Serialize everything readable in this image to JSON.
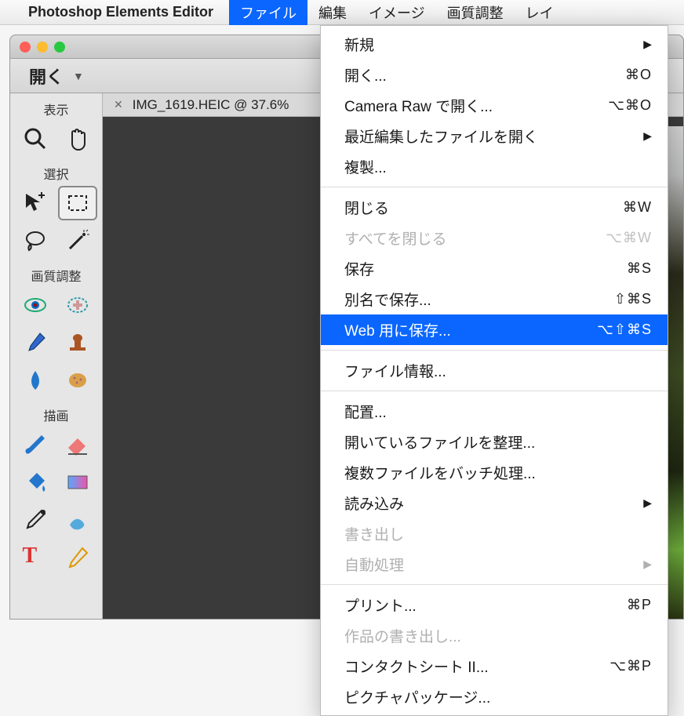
{
  "menubar": {
    "app_name": "Photoshop Elements Editor",
    "items": [
      "ファイル",
      "編集",
      "イメージ",
      "画質調整",
      "レイ"
    ]
  },
  "window": {
    "open_label": "開く"
  },
  "tools": {
    "sections": [
      "表示",
      "選択",
      "画質調整",
      "描画"
    ]
  },
  "document": {
    "tab_title": "IMG_1619.HEIC @ 37.6%"
  },
  "file_menu": [
    {
      "label": "新規",
      "shortcut": "",
      "arrow": true
    },
    {
      "label": "開く...",
      "shortcut": "⌘O"
    },
    {
      "label": "Camera Raw で開く...",
      "shortcut": "⌥⌘O"
    },
    {
      "label": "最近編集したファイルを開く",
      "shortcut": "",
      "arrow": true
    },
    {
      "label": "複製..."
    },
    {
      "sep": true
    },
    {
      "label": "閉じる",
      "shortcut": "⌘W"
    },
    {
      "label": "すべてを閉じる",
      "shortcut": "⌥⌘W",
      "disabled": true
    },
    {
      "label": "保存",
      "shortcut": "⌘S"
    },
    {
      "label": "別名で保存...",
      "shortcut": "⇧⌘S"
    },
    {
      "label": "Web 用に保存...",
      "shortcut": "⌥⇧⌘S",
      "highlight": true
    },
    {
      "sep": true
    },
    {
      "label": "ファイル情報..."
    },
    {
      "sep": true
    },
    {
      "label": "配置..."
    },
    {
      "label": "開いているファイルを整理..."
    },
    {
      "label": "複数ファイルをバッチ処理..."
    },
    {
      "label": "読み込み",
      "arrow": true
    },
    {
      "label": "書き出し",
      "disabled": true
    },
    {
      "label": "自動処理",
      "arrow": true,
      "disabled": true
    },
    {
      "sep": true
    },
    {
      "label": "プリント...",
      "shortcut": "⌘P"
    },
    {
      "label": "作品の書き出し...",
      "disabled": true
    },
    {
      "label": "コンタクトシート II...",
      "shortcut": "⌥⌘P"
    },
    {
      "label": "ピクチャパッケージ..."
    }
  ]
}
